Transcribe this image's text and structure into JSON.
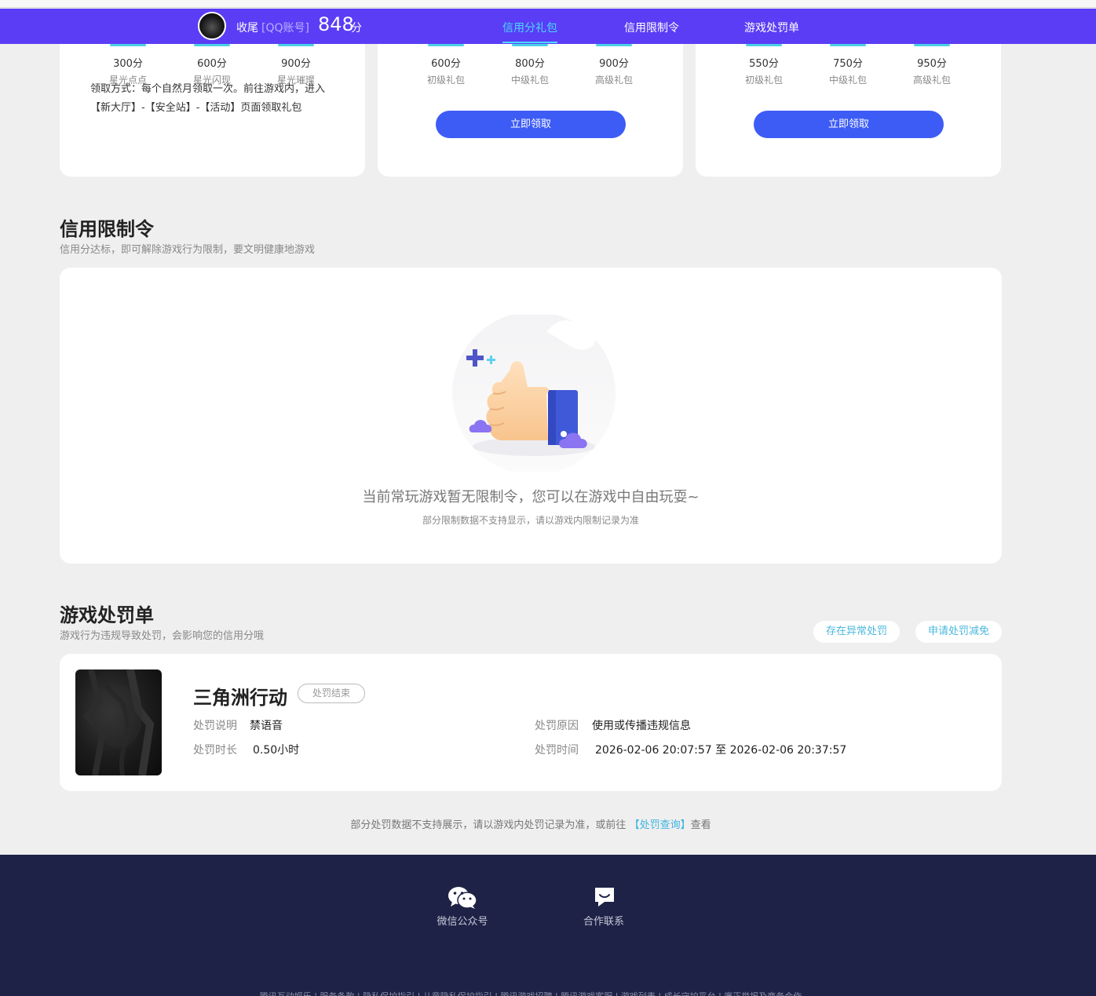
{
  "navbar": {
    "username": "收尾",
    "account_type": "[QQ账号]",
    "score": "848",
    "score_unit": "分",
    "tabs": [
      {
        "label": "信用分礼包",
        "active": true
      },
      {
        "label": "信用限制令",
        "active": false
      },
      {
        "label": "游戏处罚单",
        "active": false
      }
    ]
  },
  "gift_cards": [
    {
      "tiers": [
        {
          "score": "300分",
          "name": "星光点点"
        },
        {
          "score": "600分",
          "name": "星光闪现"
        },
        {
          "score": "900分",
          "name": "星光璀璨"
        }
      ],
      "claim_text": "领取方式：每个自然月领取一次。前往游戏内，进入【新大厅】-【安全站】-【活动】页面领取礼包"
    },
    {
      "tiers": [
        {
          "score": "600分",
          "name": "初级礼包"
        },
        {
          "score": "800分",
          "name": "中级礼包"
        },
        {
          "score": "900分",
          "name": "高级礼包"
        }
      ],
      "button": "立即领取"
    },
    {
      "tiers": [
        {
          "score": "550分",
          "name": "初级礼包"
        },
        {
          "score": "750分",
          "name": "中级礼包"
        },
        {
          "score": "950分",
          "name": "高级礼包"
        }
      ],
      "button": "立即领取"
    }
  ],
  "restriction": {
    "title": "信用限制令",
    "subtitle": "信用分达标，即可解除游戏行为限制，要文明健康地游戏",
    "empty_message": "当前常玩游戏暂无限制令，您可以在游戏中自由玩耍~",
    "empty_note": "部分限制数据不支持显示，请以游戏内限制记录为准"
  },
  "penalty": {
    "title": "游戏处罚单",
    "subtitle": "游戏行为违规导致处罚，会影响您的信用分哦",
    "abnormal_button": "存在异常处罚",
    "appeal_button": "申请处罚减免",
    "record": {
      "game": "三角洲行动",
      "status": "处罚结束",
      "desc_label": "处罚说明",
      "desc_value": "禁语音",
      "reason_label": "处罚原因",
      "reason_value": "使用或传播违规信息",
      "duration_label": "处罚时长",
      "duration_value": "0.50小时",
      "time_label": "处罚时间",
      "time_value": "2026-02-06 20:07:57 至 2026-02-06 20:37:57"
    },
    "footnote_prefix": "部分处罚数据不支持展示，请以游戏内处罚记录为准，或前往",
    "footnote_link": "【处罚查询】",
    "footnote_suffix": "查看"
  },
  "footer": {
    "wechat_label": "微信公众号",
    "contact_label": "合作联系",
    "links_line": "腾讯互动娱乐 | 服务条款 | 隐私保护指引 | 儿童隐私保护指引 | 腾讯游戏招聘 | 腾讯游戏客服 | 游戏列表 | 成长守护平台 | 廉正举报及商务合作"
  },
  "colors": {
    "navbar": "#5b3df6",
    "accent_cyan": "#49d8ff",
    "button_blue": "#3d5cf5",
    "footer_bg": "#1e2246"
  }
}
